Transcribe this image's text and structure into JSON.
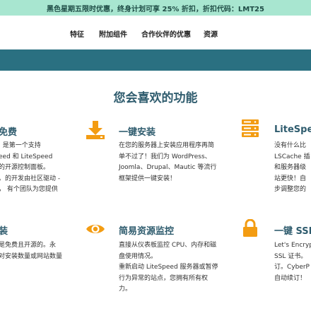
{
  "promo": {
    "text": "黑色星期五限时优惠，终身计划可享 25% 折扣，折扣代码：LMT25"
  },
  "nav": {
    "items": [
      "特征",
      "附加组件",
      "合作伙伴的优惠",
      "资源"
    ]
  },
  "section": {
    "title": "您会喜欢的功能"
  },
  "features": {
    "row1": {
      "left": {
        "title": "免费",
        "lines": [
          ", 是第一个支持",
          "eed 和 LiteSpeed",
          "的开源控制面板。",
          "。的开发由社区驱动 -",
          "， 有个团队为您提供"
        ]
      },
      "middle": {
        "title": "一键安装",
        "icon": "download-icon",
        "lines": [
          "在您的服务器上安装应用程序再简",
          "单不过了！我们为 WordPress、",
          "Joomla、Drupal、Mautic 等流行",
          "框架提供一键安装！"
        ]
      },
      "right": {
        "title": "LiteSpee",
        "icon": "server-icon",
        "lines": [
          "没有什么比",
          "LSCache 插",
          "和服务器级",
          "站更快！自",
          "步调整您的"
        ]
      }
    },
    "row2": {
      "left": {
        "title": "装",
        "lines": [
          "是免费且开源的。永",
          "对安装数量或网站数量"
        ]
      },
      "middle": {
        "title": "简易资源监控",
        "icon": "eye-icon",
        "lines": [
          "直接从仪表板监控 CPU、内存和磁",
          "盘使用情况。",
          "重新启动 LiteSpeed 服务器或暂停",
          "行为异常的站点，您拥有所有权",
          "力。"
        ]
      },
      "right": {
        "title": "一键 SSL",
        "icon": "lock-icon",
        "lines": [
          "Let's Encryp",
          "SSL 证书。",
          "订。CyberP",
          "自动续订！"
        ]
      }
    }
  },
  "colors": {
    "promo_bg": "#a8e6d0",
    "band": "#2a7081",
    "heading": "#2f5c6e",
    "accent_orange": "#f39c12"
  }
}
